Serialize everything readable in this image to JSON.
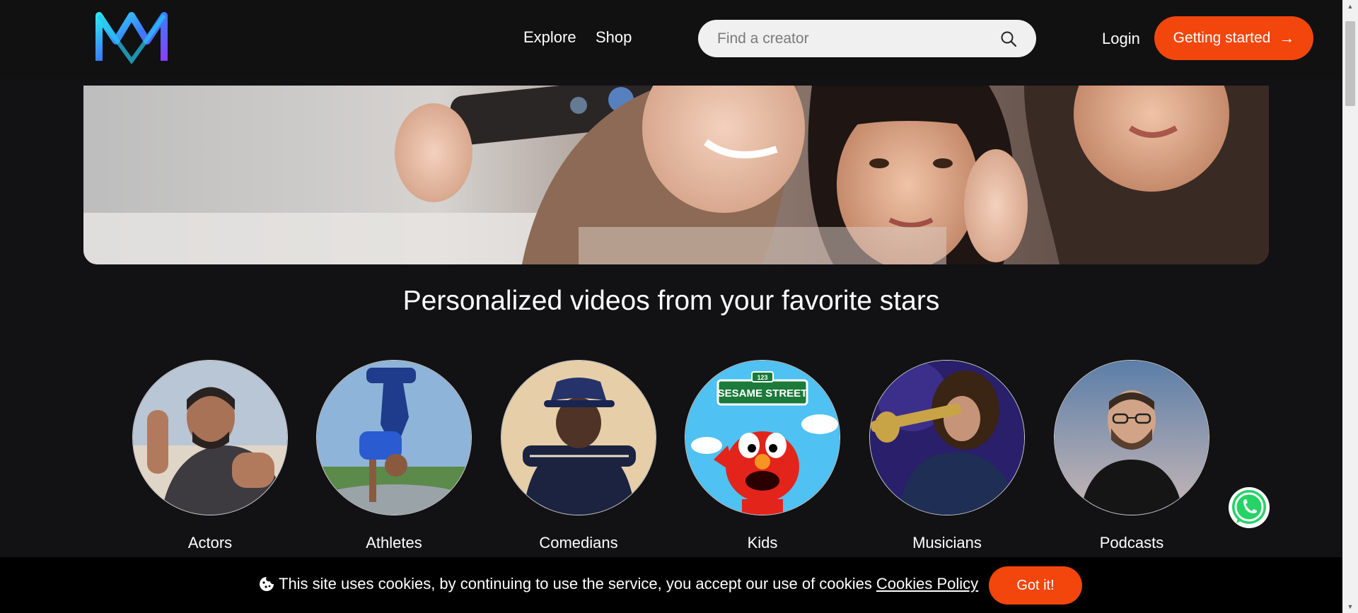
{
  "header": {
    "nav": [
      {
        "label": "Explore"
      },
      {
        "label": "Shop"
      }
    ],
    "search": {
      "placeholder": "Find a creator",
      "value": ""
    },
    "login_label": "Login",
    "cta_label": "Getting started",
    "cta_arrow": "→"
  },
  "headline": "Personalized videos from your favorite stars",
  "categories": [
    {
      "label": "Actors"
    },
    {
      "label": "Athletes"
    },
    {
      "label": "Comedians"
    },
    {
      "label": "Kids",
      "sign_text": "SESAME STREET",
      "sign_number": "123"
    },
    {
      "label": "Musicians"
    },
    {
      "label": "Podcasts"
    }
  ],
  "cookie": {
    "text": "This site uses cookies, by continuing to use the service, you accept our use of cookies",
    "link_label": "Cookies Policy",
    "button_label": "Got it!"
  },
  "colors": {
    "accent": "#f2460c",
    "background": "#121114",
    "header_bg": "#111111"
  },
  "icons": {
    "logo": "brand-logo",
    "search": "search-icon",
    "whatsapp": "whatsapp-icon",
    "cookie": "cookie-icon"
  }
}
